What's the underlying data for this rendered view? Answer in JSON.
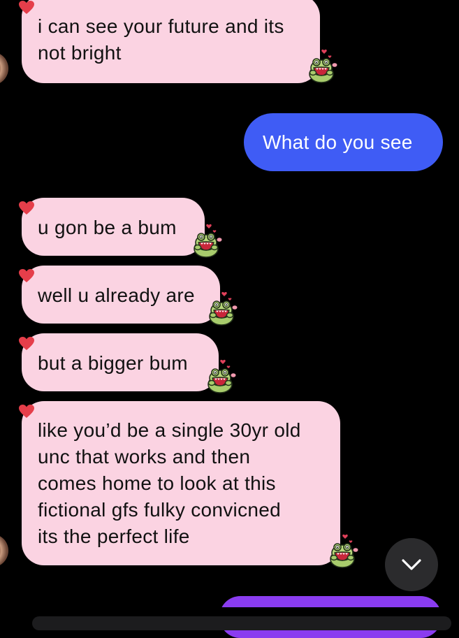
{
  "colors": {
    "background": "#000000",
    "incoming_bubble": "#fbd3e2",
    "outgoing_bubble": "#3f5cf5",
    "next_outgoing_bubble": "#8a3cf0",
    "heart": "#e53e4a",
    "scroll_button": "#2b2b2d"
  },
  "messages": [
    {
      "direction": "incoming",
      "lines": [
        "i can see your future and its",
        "not bright"
      ],
      "reaction": "heart",
      "sticker": "frog-hearts-sticker"
    },
    {
      "direction": "outgoing",
      "lines": [
        "What do you see"
      ]
    },
    {
      "direction": "incoming",
      "lines": [
        "u gon be a bum"
      ],
      "reaction": "heart",
      "sticker": "frog-hearts-sticker"
    },
    {
      "direction": "incoming",
      "lines": [
        "well u already are"
      ],
      "reaction": "heart",
      "sticker": "frog-hearts-sticker"
    },
    {
      "direction": "incoming",
      "lines": [
        "but a bigger bum"
      ],
      "reaction": "heart",
      "sticker": "frog-hearts-sticker"
    },
    {
      "direction": "incoming",
      "lines": [
        "like you’d be a single 30yr old",
        "unc that works and then",
        "comes home to look at this",
        "fictional gfs fulky convicned",
        "its the perfect life"
      ],
      "reaction": "heart",
      "sticker": "frog-hearts-sticker"
    }
  ],
  "scroll_button": {
    "icon": "chevron-down-icon"
  }
}
